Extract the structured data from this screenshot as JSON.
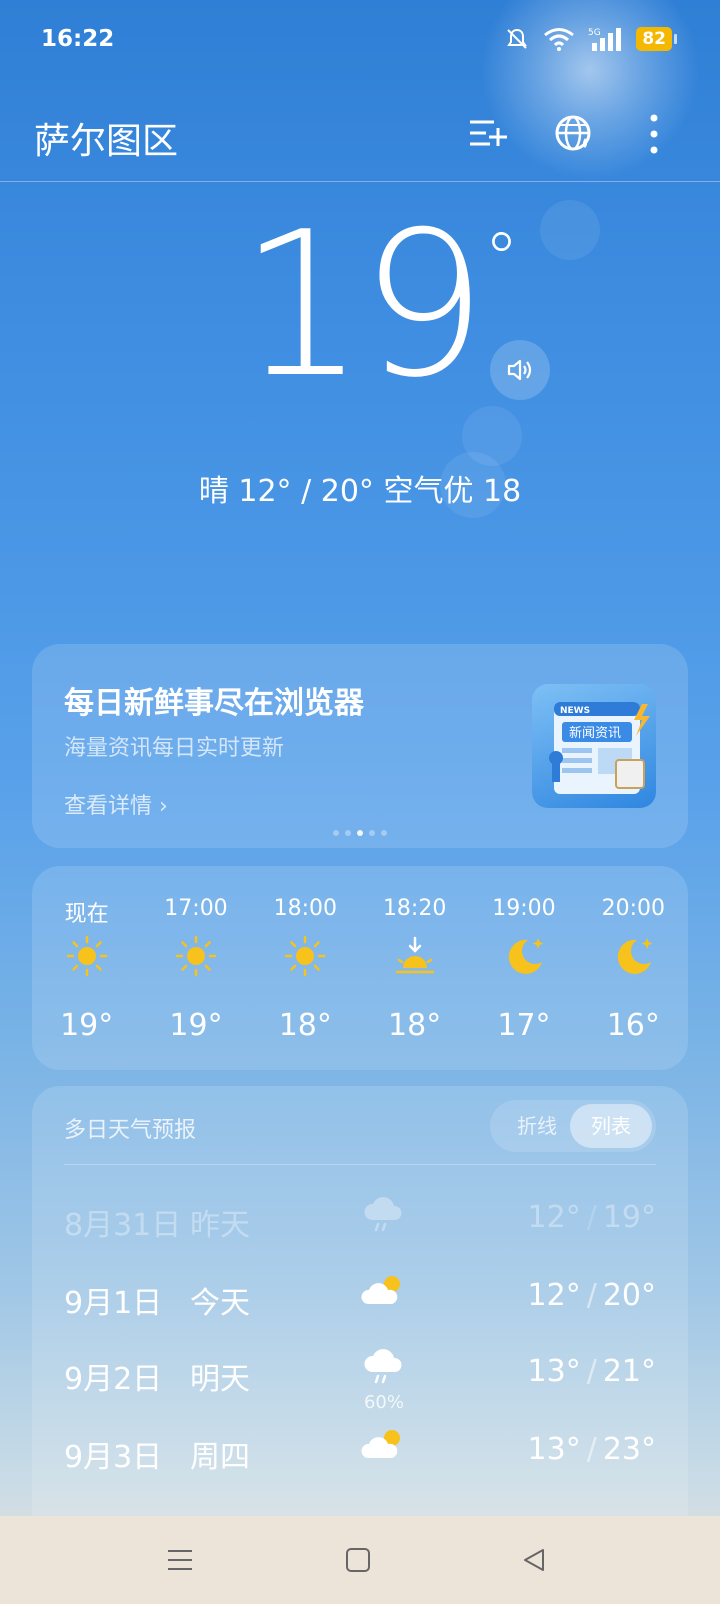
{
  "status_bar": {
    "time": "16:22",
    "battery": "82",
    "network": "5G"
  },
  "header": {
    "city": "萨尔图区"
  },
  "current": {
    "temperature": "19",
    "degree_symbol": "°",
    "summary": "晴 12° / 20° 空气优 18"
  },
  "ad": {
    "title": "每日新鲜事尽在浏览器",
    "subtitle": "海量资讯每日实时更新",
    "link": "查看详情 ›",
    "thumb_tag": "NEWS",
    "thumb_title": "新闻资讯",
    "page_index": 2,
    "page_count": 5
  },
  "hourly": [
    {
      "time": "现在",
      "icon": "sun-icon",
      "temp": "19°"
    },
    {
      "time": "17:00",
      "icon": "sun-icon",
      "temp": "19°"
    },
    {
      "time": "18:00",
      "icon": "sun-icon",
      "temp": "18°"
    },
    {
      "time": "18:20",
      "icon": "sunset-icon",
      "temp": "18°"
    },
    {
      "time": "19:00",
      "icon": "moon-icon",
      "temp": "17°"
    },
    {
      "time": "20:00",
      "icon": "moon-icon",
      "temp": "16°"
    }
  ],
  "daily": {
    "title": "多日天气预报",
    "toggle": {
      "line_label": "折线",
      "list_label": "列表",
      "selected": "列表"
    },
    "rows": [
      {
        "date": "8月31日",
        "day": "昨天",
        "icon": "rain-cloud-icon",
        "precip": "",
        "low": "12°",
        "high": "19°"
      },
      {
        "date": "9月1日",
        "day": "今天",
        "icon": "partly-cloudy-icon",
        "precip": "",
        "low": "12°",
        "high": "20°"
      },
      {
        "date": "9月2日",
        "day": "明天",
        "icon": "rain-cloud-icon",
        "precip": "60%",
        "low": "13°",
        "high": "21°"
      },
      {
        "date": "9月3日",
        "day": "周四",
        "icon": "partly-cloudy-icon",
        "precip": "",
        "low": "13°",
        "high": "23°"
      }
    ]
  },
  "colors": {
    "sun": "#f7c21b",
    "battery": "#f5b800",
    "sky": "#3d8ce0"
  }
}
